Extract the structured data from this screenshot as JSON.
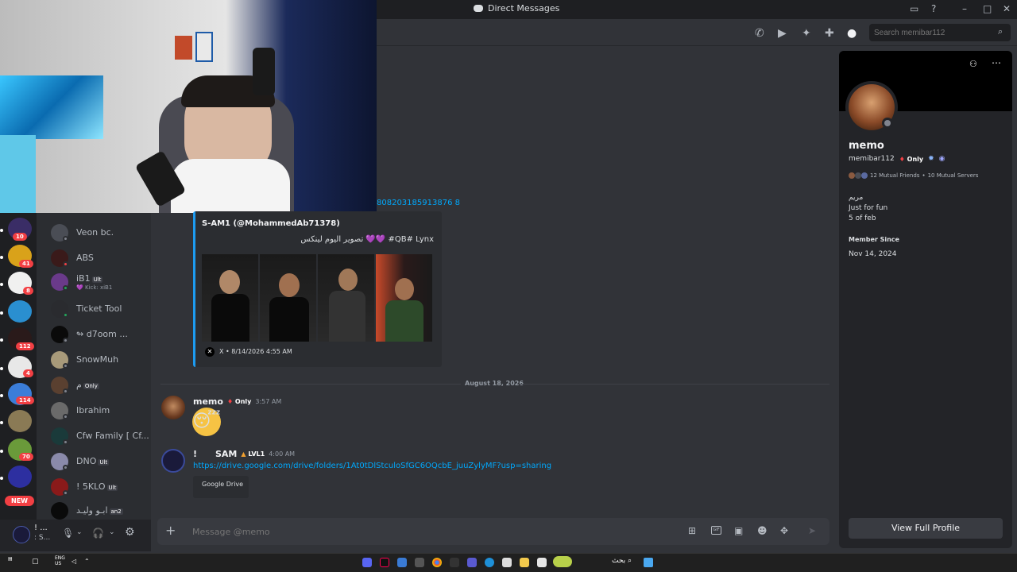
{
  "window": {
    "title": "Direct Messages",
    "search_placeholder": "Search memibar112"
  },
  "guilds": [
    {
      "badge": "10",
      "color": "#3a2d66"
    },
    {
      "badge": "41",
      "color": "#d9a21a"
    },
    {
      "badge": "8",
      "color": "#f0f0f0"
    },
    {
      "badge": "",
      "color": "#2a8fd0"
    },
    {
      "badge": "112",
      "color": "#2a1a1a"
    },
    {
      "badge": "4",
      "color": "#e8e8e8"
    },
    {
      "badge": "114",
      "color": "#3b7dd8"
    },
    {
      "badge": "",
      "color": "#8a7a55"
    },
    {
      "badge": "70",
      "color": "#6a9a3a"
    },
    {
      "badge": "",
      "color": "#2d2fa0"
    },
    {
      "badge": "NEW",
      "color": "#f23f43"
    }
  ],
  "dms": [
    {
      "name": "Veon bc.",
      "sub": "",
      "tag": ""
    },
    {
      "name": "ABS",
      "sub": "",
      "tag": ""
    },
    {
      "name": "iB1",
      "sub": "💜 Kick: xiB1",
      "tag": "Ult"
    },
    {
      "name": "Ticket Tool",
      "sub": "",
      "tag": ""
    },
    {
      "name": "↬ d7oom ...",
      "sub": "",
      "tag": ""
    },
    {
      "name": "SnowMuh",
      "sub": "",
      "tag": ""
    },
    {
      "name": "م",
      "sub": "",
      "tag": "Only"
    },
    {
      "name": "Ibrahim",
      "sub": "",
      "tag": ""
    },
    {
      "name": "Cfw Family [ Cf...",
      "sub": "",
      "tag": ""
    },
    {
      "name": "DNO",
      "sub": "",
      "tag": "Ult"
    },
    {
      "name": "! 5KLO",
      "sub": "",
      "tag": "Ult"
    },
    {
      "name": "ابـو وليـد",
      "sub": "",
      "tag": "an2"
    }
  ],
  "user_panel": {
    "name": "! ...",
    "sub": ": S..."
  },
  "chat": {
    "partial_link": "808203185913876 8",
    "embed": {
      "author": "S-AM1 (@MohammedAb71378)",
      "text": "تصوير اليوم لينكس 💜💜 #QB# Lynx",
      "footer": "X • 8/14/2026 4:55 AM"
    },
    "date_divider": "August 18, 2026",
    "messages": [
      {
        "author": "memo",
        "badge": "Only",
        "time": "3:57 AM",
        "content": "😴"
      },
      {
        "author": "!      SAM",
        "badge": "LVL1",
        "time": "4:00 AM",
        "content": "https://drive.google.com/drive/folders/1At0tDlStculoSfGC6OQcbE_juuZylyMF?usp=sharing",
        "embed_title": "Google Drive"
      }
    ],
    "composer_placeholder": "Message @memo"
  },
  "profile": {
    "display_name": "memo",
    "username": "memibar112",
    "username_tag": "Only",
    "mutual_friends": "12 Mutual Friends",
    "mutual_servers": "10 Mutual Servers",
    "bio_line1": "مريم",
    "bio_line2": "Just for fun",
    "bio_line3": "5 of feb",
    "member_since_label": "Member Since",
    "member_since": "Nov 14, 2024",
    "full_profile_button": "View Full Profile"
  },
  "taskbar": {
    "lang": "ENG",
    "region": "US",
    "search_text": "بحث"
  }
}
